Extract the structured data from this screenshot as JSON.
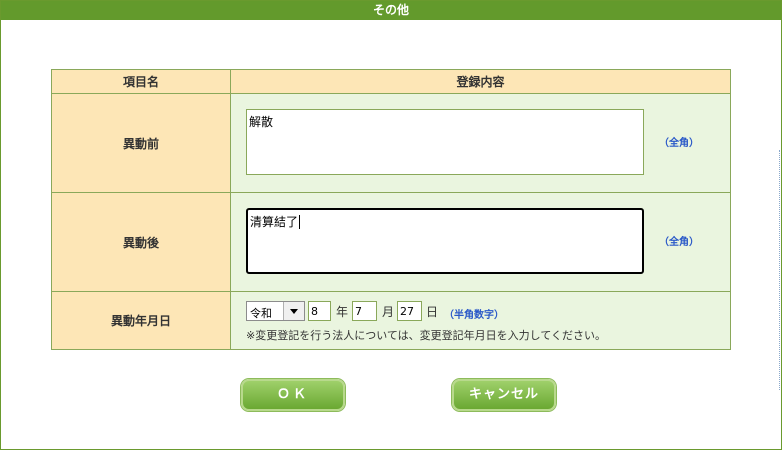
{
  "dialog": {
    "title": "その他"
  },
  "table": {
    "header_item": "項目名",
    "header_content": "登録内容",
    "rows": [
      {
        "label": "異動前",
        "value": "解散",
        "hint": "（全角）"
      },
      {
        "label": "異動後",
        "value": "清算結了",
        "hint": "（全角）"
      }
    ],
    "date_row": {
      "label": "異動年月日",
      "era": "令和",
      "year": "8",
      "year_unit": "年",
      "month": "7",
      "month_unit": "月",
      "day": "27",
      "day_unit": "日",
      "hint": "（半角数字）",
      "note": "※変更登記を行う法人については、変更登記年月日を入力してください。"
    }
  },
  "buttons": {
    "ok": "ＯＫ",
    "cancel": "キャンセル"
  },
  "colors": {
    "title_bar": "#639a2c",
    "header_bg": "#fde6b6",
    "content_bg": "#eaf5df",
    "hint_text": "#2a58c8",
    "button_green": "#6aa832"
  }
}
